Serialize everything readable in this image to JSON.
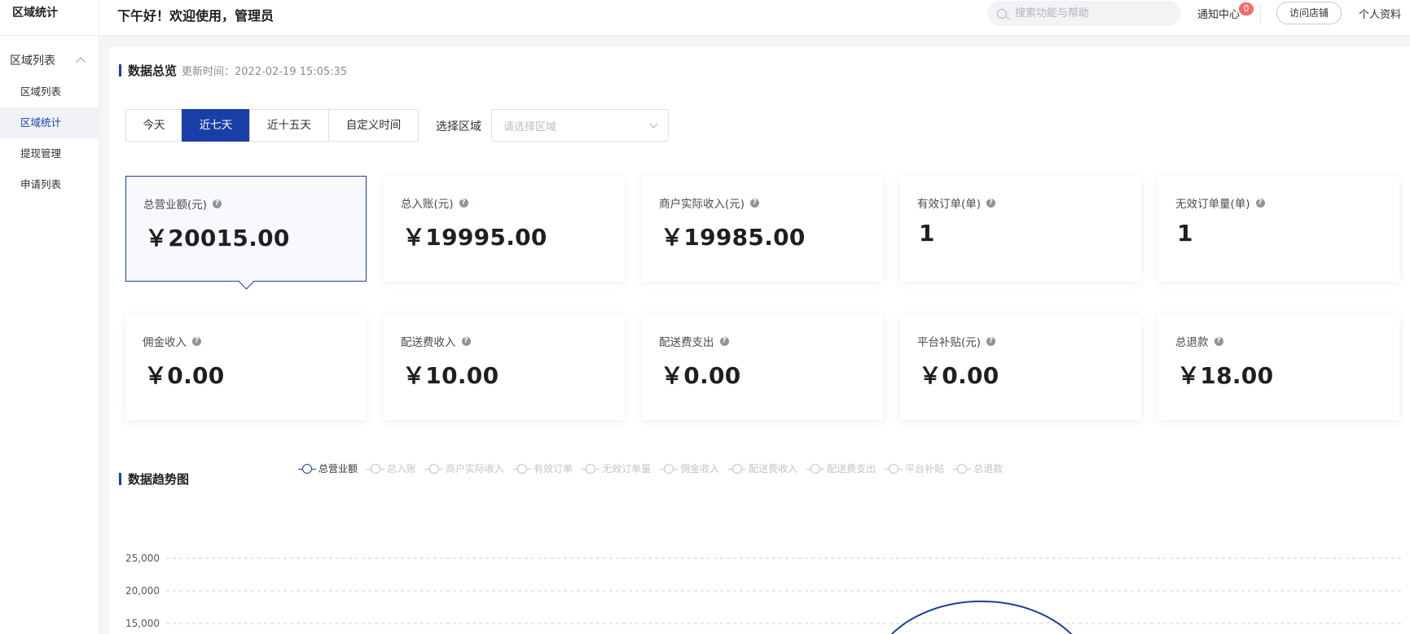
{
  "sidebar": {
    "title": "区域统计",
    "group_label": "区域列表",
    "items": [
      {
        "label": "区域列表"
      },
      {
        "label": "区域统计"
      },
      {
        "label": "提现管理"
      },
      {
        "label": "申请列表"
      }
    ]
  },
  "header": {
    "greeting": "下午好！欢迎使用，管理员",
    "search_placeholder": "搜索功能与帮助",
    "notice_label": "通知中心",
    "notice_count": "0",
    "visit_store": "访问店铺",
    "profile": "个人资料"
  },
  "overview": {
    "title": "数据总览",
    "update_time": "更新时间：2022-02-19 15:05:35",
    "ranges": [
      "今天",
      "近七天",
      "近十五天",
      "自定义时间"
    ],
    "active_range": "近七天",
    "area_label": "选择区域",
    "area_placeholder": "请选择区域",
    "cards": [
      {
        "label": "总营业额(元)",
        "value": "￥20015.00"
      },
      {
        "label": "总入账(元)",
        "value": "￥19995.00"
      },
      {
        "label": "商户实际收入(元)",
        "value": "￥19985.00"
      },
      {
        "label": "有效订单(单)",
        "value": "1"
      },
      {
        "label": "无效订单量(单)",
        "value": "1"
      },
      {
        "label": "佣金收入",
        "value": "￥0.00"
      },
      {
        "label": "配送费收入",
        "value": "￥10.00"
      },
      {
        "label": "配送费支出",
        "value": "￥0.00"
      },
      {
        "label": "平台补贴(元)",
        "value": "￥0.00"
      },
      {
        "label": "总退款",
        "value": "￥18.00"
      }
    ]
  },
  "trend": {
    "title": "数据趋势图"
  },
  "colors": {
    "accent": "#1a3ea8",
    "badge": "#f56c6c"
  },
  "chart_data": {
    "type": "line",
    "legend": [
      "总营业额",
      "总入账",
      "商户实际收入",
      "有效订单",
      "无效订单量",
      "佣金收入",
      "配送费收入",
      "配送费支出",
      "平台补贴",
      "总退款"
    ],
    "active_series": "总营业额",
    "y_ticks": [
      25000,
      20000,
      15000
    ],
    "y_tick_labels": [
      "25,000",
      "20,000",
      "15,000"
    ],
    "series": [
      {
        "name": "总营业额",
        "peak": 20015
      }
    ],
    "grid": true,
    "legend_position": "top-center"
  }
}
